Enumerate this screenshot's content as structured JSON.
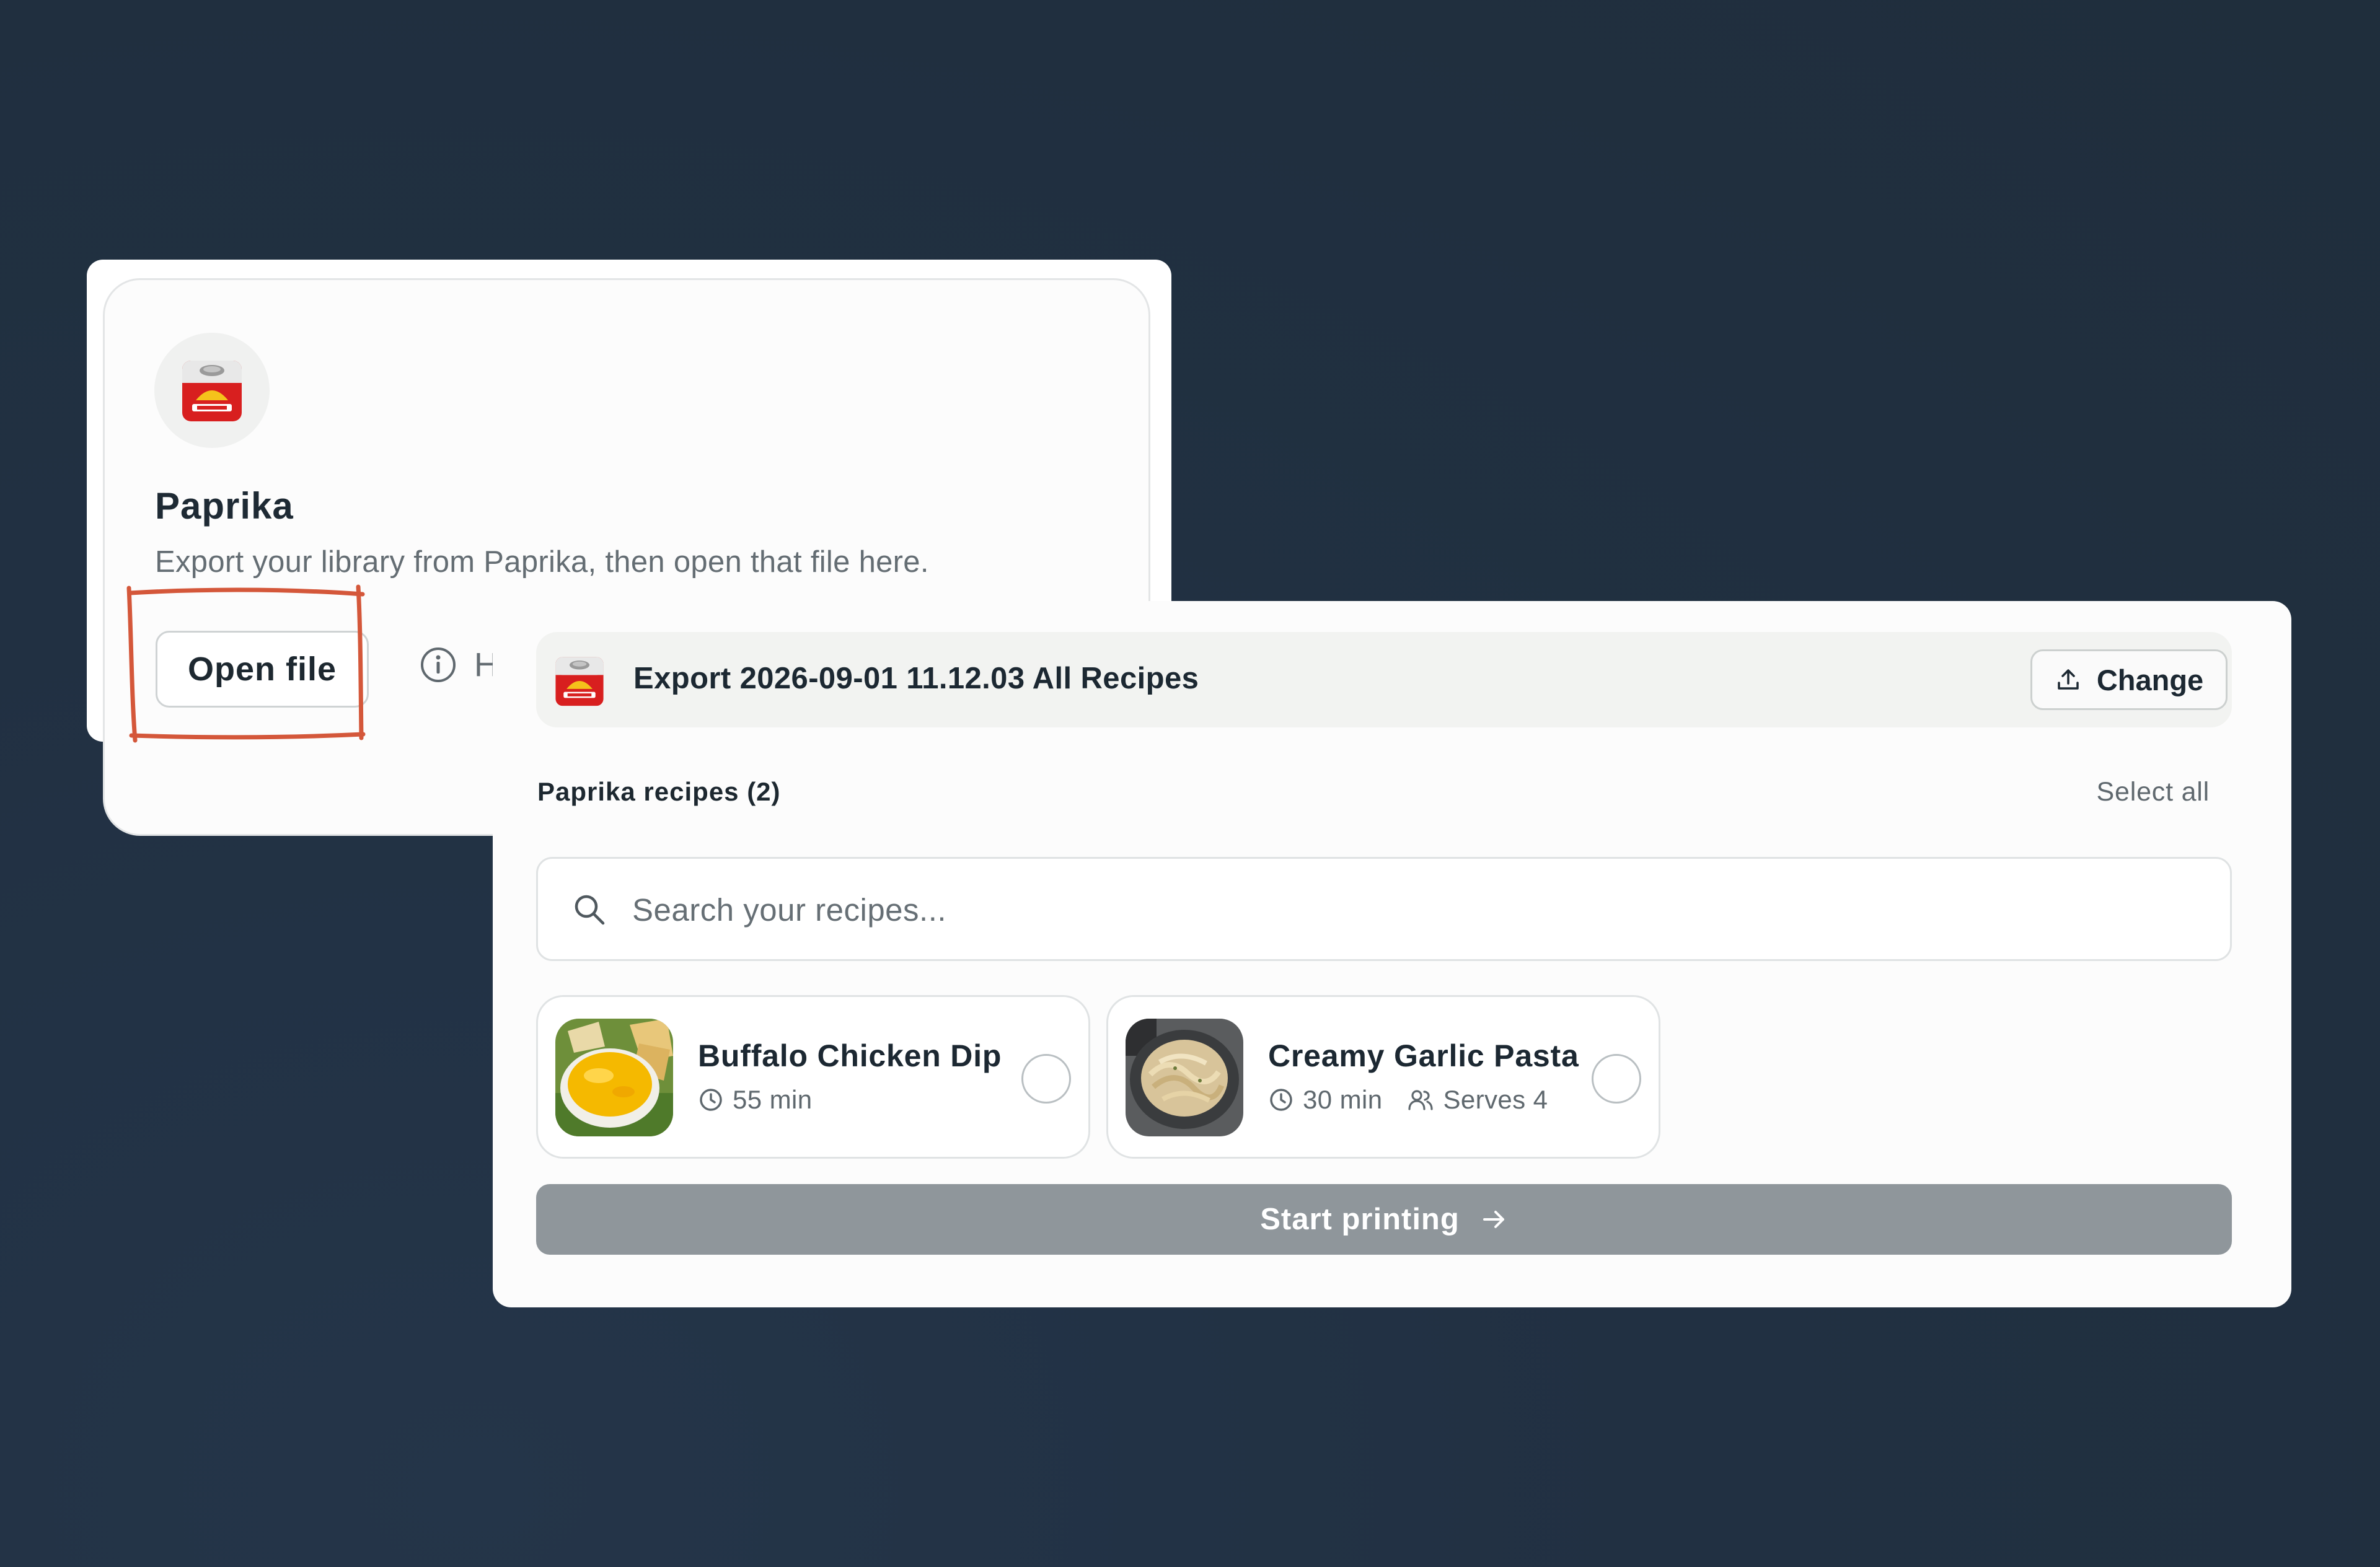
{
  "source_card": {
    "title": "Paprika",
    "description": "Export your library from Paprika, then open that file here.",
    "open_file_label": "Open file",
    "help_label": "Ho",
    "icons": {
      "app": "paprika-app-icon",
      "help": "info-circle-icon"
    }
  },
  "import_panel": {
    "file_name": "Export 2026-09-01 11.12.03 All Recipes",
    "change_label": "Change",
    "section_label": "Paprika recipes (2)",
    "select_all_label": "Select all",
    "search": {
      "placeholder": "Search your recipes...",
      "value": ""
    },
    "recipes": [
      {
        "title": "Buffalo Chicken Dip",
        "time": "55 min",
        "serves": "",
        "selected": false
      },
      {
        "title": "Creamy Garlic Pasta",
        "time": "30 min",
        "serves": "Serves 4",
        "selected": false
      }
    ],
    "start_label": "Start printing"
  },
  "colors": {
    "background": "#213042",
    "annotation": "#d4573a",
    "start_button": "#8f969b",
    "paprika_red": "#d81f1f",
    "paprika_yellow": "#f5c21b"
  }
}
